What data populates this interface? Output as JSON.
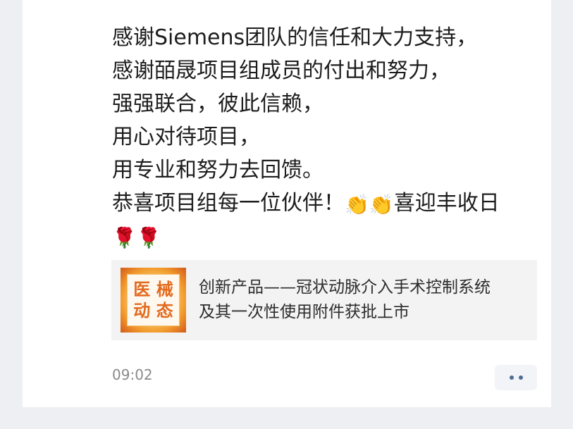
{
  "post": {
    "lines": [
      "感谢Siemens团队的信任和大力支持，",
      "感谢皕晟项目组成员的付出和努力，",
      "强强联合，彼此信赖，",
      "用心对待项目，",
      "用专业和努力去回馈。"
    ],
    "line6_before": "恭喜项目组每一位伙伴！",
    "clap_emoji": "👏👏",
    "line6_after": "喜迎丰收日",
    "rose_emoji": "🌹🌹"
  },
  "link_card": {
    "thumb_chars": [
      "医",
      "械",
      "动",
      "态"
    ],
    "title_line1": "创新产品——冠状动脉介入手术控制系统",
    "title_line2": "及其一次性使用附件获批上市"
  },
  "footer": {
    "time": "09:02"
  },
  "icons": {
    "more": "more-dots-icon",
    "clap": "clapping-hands-icon",
    "rose": "rose-icon"
  }
}
